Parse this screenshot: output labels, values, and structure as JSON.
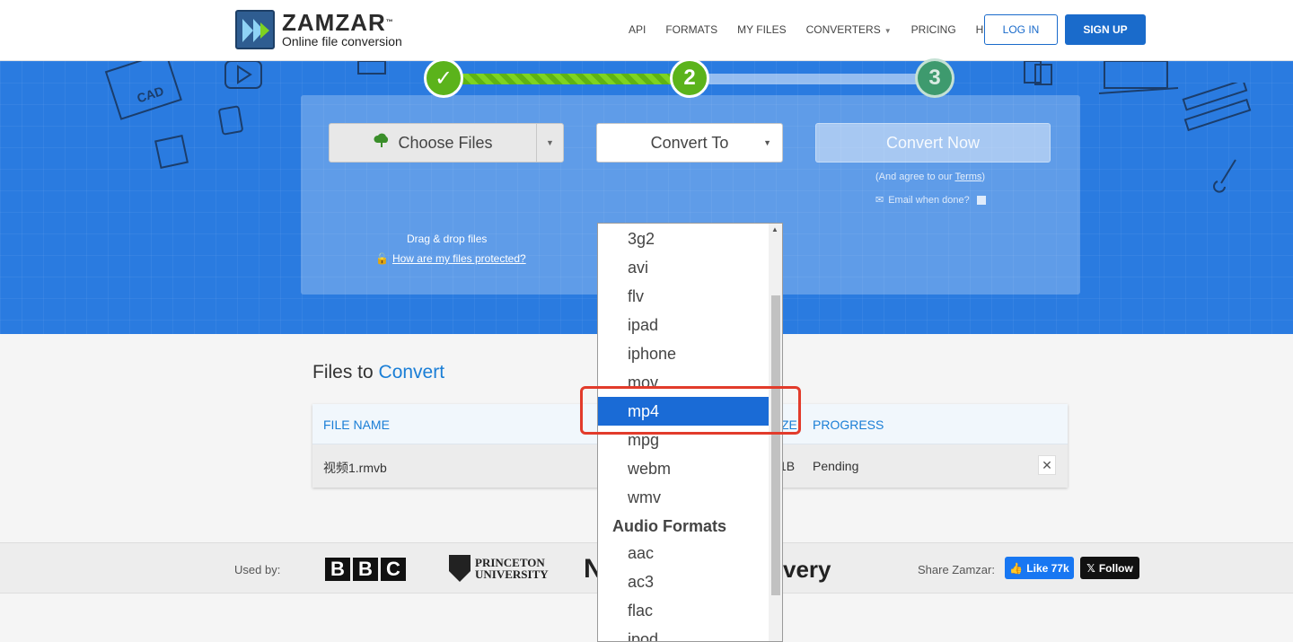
{
  "brand": {
    "name": "ZAMZAR",
    "tm": "™",
    "tagline": "Online file conversion"
  },
  "nav": {
    "items": [
      "API",
      "FORMATS",
      "MY FILES",
      "CONVERTERS",
      "PRICING",
      "HELP"
    ],
    "login": "LOG IN",
    "signup": "SIGN UP"
  },
  "steps": [
    "✓",
    "2",
    "3"
  ],
  "upload": {
    "choose_label": "Choose Files",
    "drag_hint": "Drag & drop files",
    "protect_link": "How are my files protected?"
  },
  "convert_to": {
    "label": "Convert To",
    "options": [
      "3g2",
      "avi",
      "flv",
      "ipad",
      "iphone",
      "mov",
      "mp4",
      "mpg",
      "webm",
      "wmv"
    ],
    "selected": "mp4",
    "group_label": "Audio Formats",
    "audio_options": [
      "aac",
      "ac3",
      "flac",
      "ipod"
    ]
  },
  "convert_now": {
    "label": "Convert Now",
    "agree_prefix": "(And agree to our ",
    "terms": "Terms",
    "agree_suffix": ")",
    "email_label": "Email when done?"
  },
  "files": {
    "title_prefix": "Files to",
    "title_accent": "Convert",
    "columns": [
      "FILE NAME",
      "ZE",
      "PROGRESS"
    ],
    "rows": [
      {
        "name": "视频1.rmvb",
        "size_fragment": "1B",
        "progress": "Pending"
      }
    ]
  },
  "footer": {
    "used_by": "Used by:",
    "bbc": [
      "B",
      "B",
      "C"
    ],
    "princeton_line1": "PRINCETON",
    "princeton_line2": "UNIVERSITY",
    "logo_n": "N",
    "discovery_fragment": "very",
    "share": "Share Zamzar:",
    "like": "Like 77k",
    "follow": "Follow"
  },
  "colors": {
    "primary": "#1a6bcb",
    "hero": "#2a7be0",
    "step_green": "#5bb31b",
    "selected_option": "#1a6bd6",
    "annotation": "#e23b2b"
  }
}
